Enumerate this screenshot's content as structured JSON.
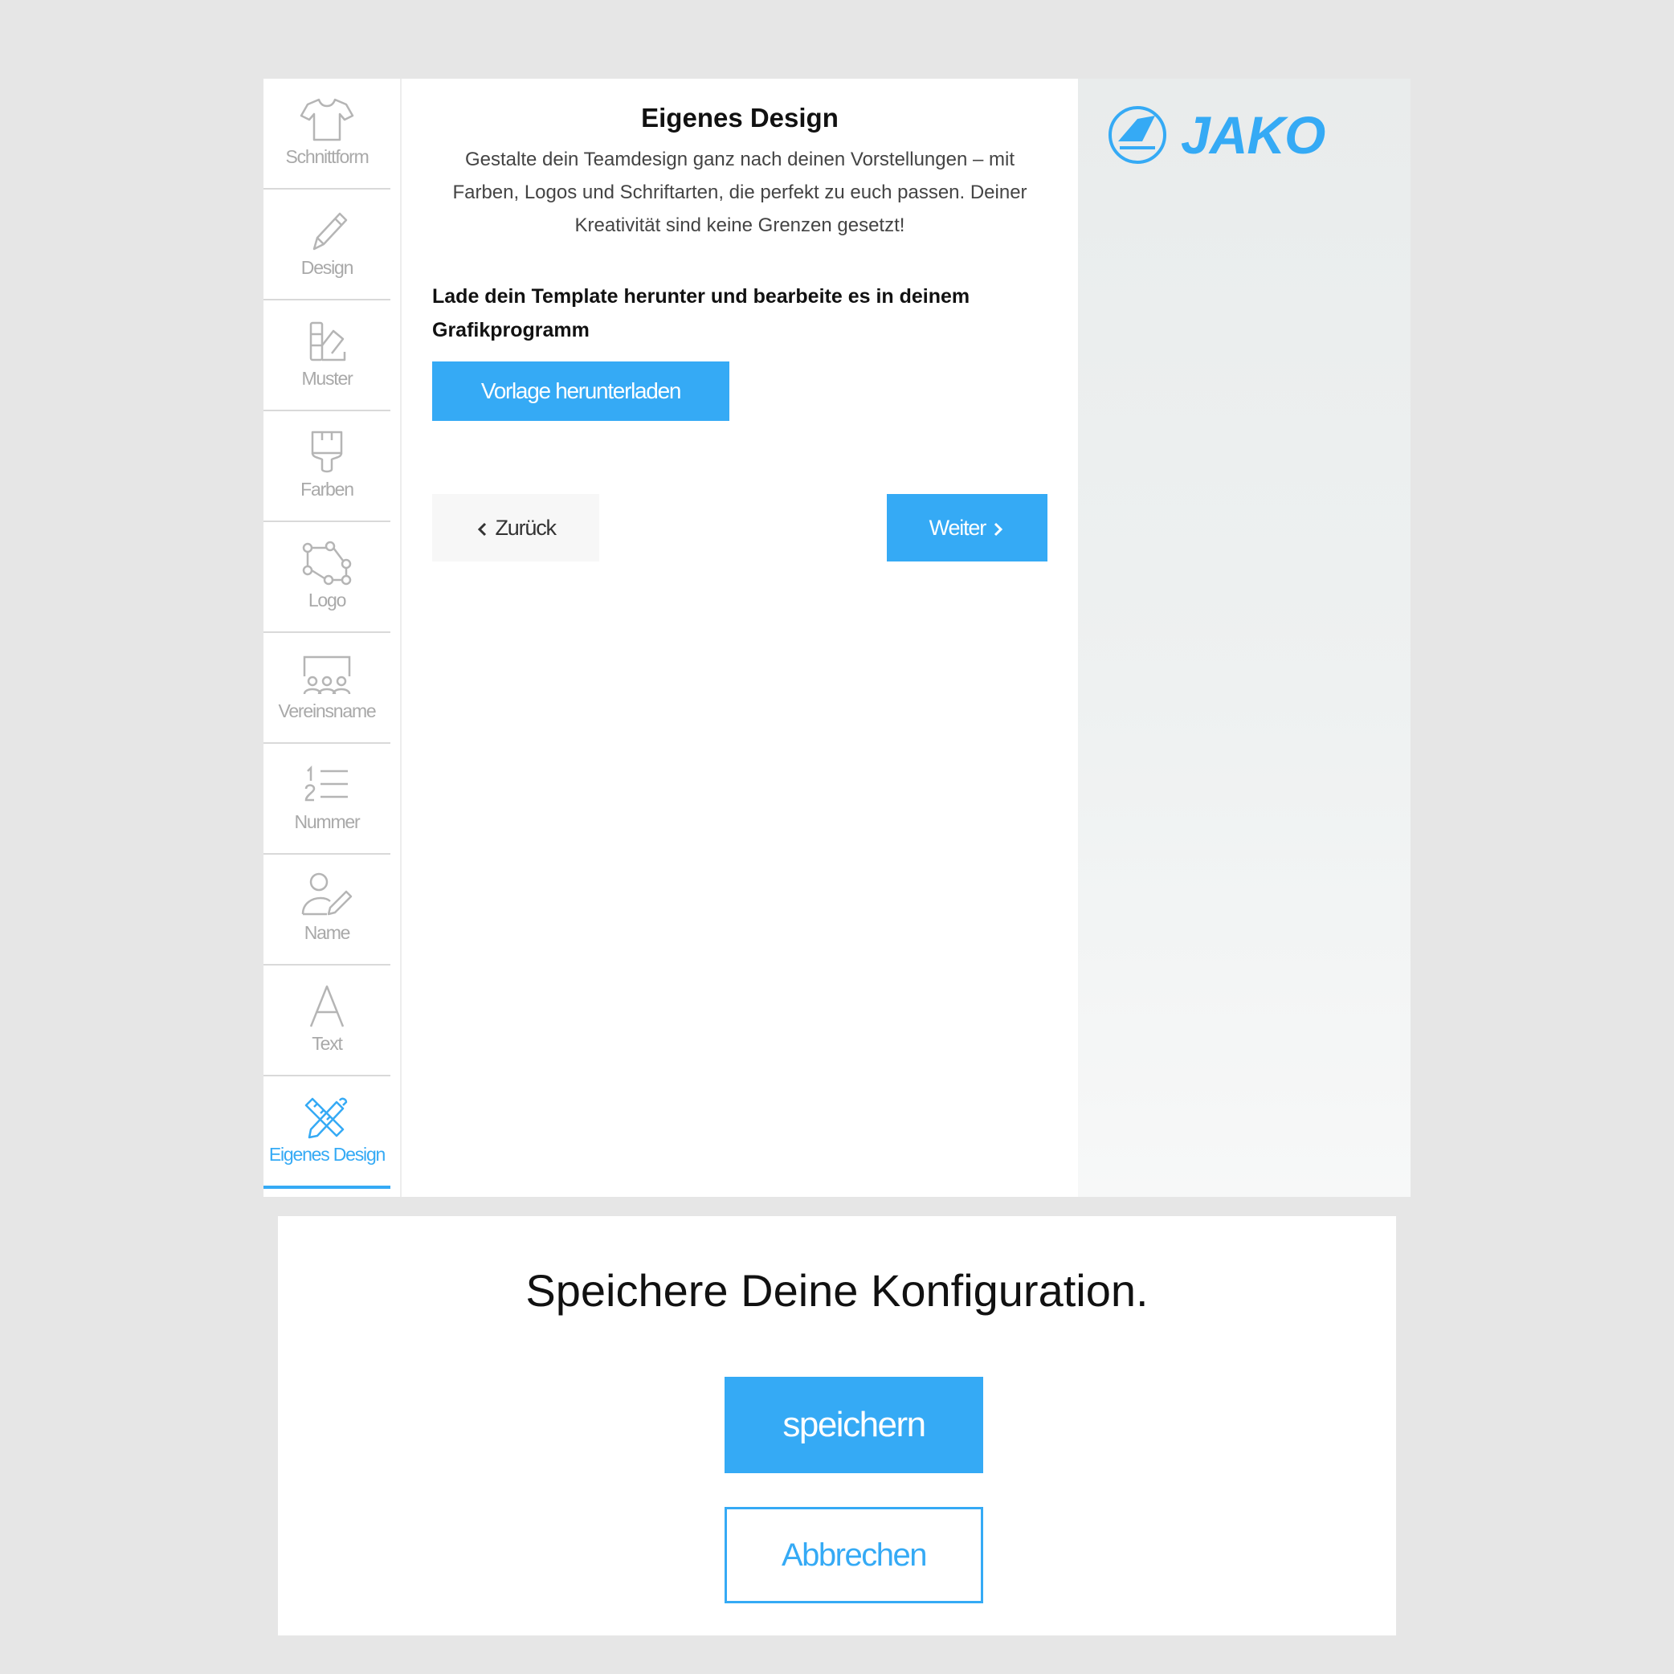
{
  "sidebar": {
    "items": [
      {
        "label": "Schnittform",
        "icon": "shirt-icon"
      },
      {
        "label": "Design",
        "icon": "pencil-icon"
      },
      {
        "label": "Muster",
        "icon": "pattern-icon"
      },
      {
        "label": "Farben",
        "icon": "paintbrush-icon"
      },
      {
        "label": "Logo",
        "icon": "logo-nodes-icon"
      },
      {
        "label": "Vereinsname",
        "icon": "team-icon"
      },
      {
        "label": "Nummer",
        "icon": "numbered-list-icon"
      },
      {
        "label": "Name",
        "icon": "user-edit-icon"
      },
      {
        "label": "Text",
        "icon": "letter-a-icon"
      },
      {
        "label": "Eigenes Design",
        "icon": "design-tools-icon",
        "active": true
      }
    ]
  },
  "content": {
    "title": "Eigenes Design",
    "description": "Gestalte dein Teamdesign ganz nach deinen Vorstellungen – mit Farben, Logos und Schriftarten, die perfekt zu euch passen. Deiner Kreativität sind keine Grenzen gesetzt!",
    "instruction": "Lade dein Template herunter und bearbeite es in deinem Grafikprogramm",
    "download_label": "Vorlage herunterladen",
    "back_label": "Zurück",
    "next_label": "Weiter"
  },
  "brand": {
    "logo_text": "JAKO",
    "accent_color": "#35aaf5"
  },
  "dialog": {
    "title": "Speichere Deine Konfiguration.",
    "save_label": "speichern",
    "cancel_label": "Abbrechen"
  }
}
